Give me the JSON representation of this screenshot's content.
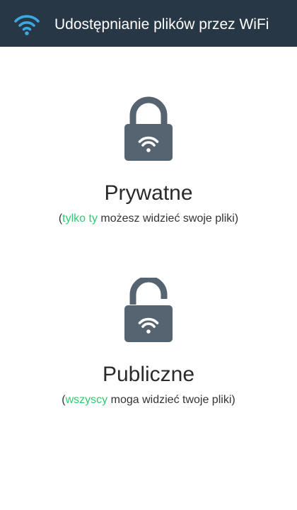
{
  "app": {
    "title": "Udostępnianie plików przez WiFi",
    "icon": "wifi-icon"
  },
  "colors": {
    "appbar": "#283745",
    "icon_blue": "#3aa9e0",
    "lock": "#566472",
    "accent": "#2ecc71"
  },
  "options": {
    "private": {
      "icon": "lock-closed-icon",
      "title": "Prywatne",
      "desc_open": "(",
      "desc_highlight": "tylko ty",
      "desc_rest": " możesz widzieć swoje pliki)"
    },
    "public": {
      "icon": "lock-open-icon",
      "title": "Publiczne",
      "desc_open": "(",
      "desc_highlight": "wszyscy",
      "desc_rest": " moga widzieć twoje pliki)"
    }
  }
}
